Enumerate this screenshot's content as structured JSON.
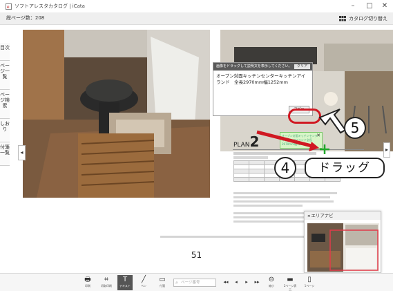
{
  "window": {
    "title": "ソフトアレスタカタログ | iCata",
    "min_glyph": "–",
    "max_glyph": "□",
    "close_glyph": "✕"
  },
  "header": {
    "page_count": "総ページ数：208",
    "catalog_switch": "カタログ切り替え"
  },
  "side_tabs": [
    "目次",
    "ページ一覧",
    "ページ検索",
    "しおり",
    "付箋一覧"
  ],
  "nav": {
    "prev_glyph": "◂",
    "next_glyph": "▸"
  },
  "dialog": {
    "header": "画像をドラッグして説明文を表示してください。",
    "clear_label": "クリア",
    "text": "オープン対面キッチンセンターキッチンアイランド　全長2970mm幅1252mm",
    "copy_label": "コピー"
  },
  "annotations": {
    "step4": "4",
    "step5": "5",
    "drag_label": "ドラッグ"
  },
  "plan": {
    "title_prefix": "PLAN",
    "title_number": "2",
    "sticky_text": "オープン対面キッチンセンターキッチンアイランド全長2970mm幅1252mm"
  },
  "page_number": "51",
  "area_navi": {
    "title": "エリアナビ",
    "arrow": "◂"
  },
  "toolbar": {
    "tools": [
      {
        "glyph": "🖶",
        "label": "印刷"
      },
      {
        "glyph": "⌗",
        "label": "切取印刷"
      },
      {
        "glyph": "T",
        "label": "テキスト"
      },
      {
        "glyph": "╱",
        "label": "ペン"
      },
      {
        "glyph": "▭",
        "label": "付箋"
      }
    ],
    "page_input_placeholder": "ページ番号",
    "nav": [
      "◂◂",
      "◂",
      "▸",
      "▸▸"
    ],
    "right_tools": [
      {
        "glyph": "⊖",
        "label": "縮小"
      },
      {
        "glyph": "▬",
        "label": "2ページ表示"
      },
      {
        "glyph": "▯",
        "label": "1ページ"
      }
    ]
  },
  "colors": {
    "highlight_ring": "#d01822",
    "drag_arrow": "#d01822",
    "drop_cross": "#1fa82a"
  }
}
